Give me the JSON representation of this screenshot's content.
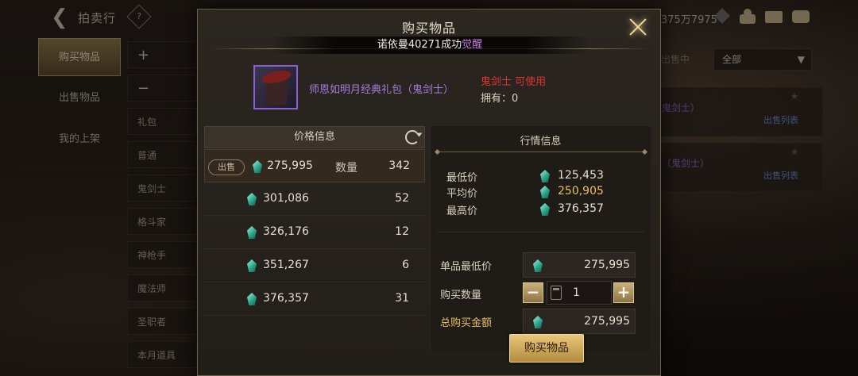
{
  "background": {
    "title": "拍卖行",
    "help_icon": "?",
    "currency": "375万7975",
    "left_tabs": [
      "购买物品",
      "出售物品",
      "我的上架"
    ],
    "categories": [
      "+",
      "−",
      "礼包",
      "普通",
      "鬼剑士",
      "格斗家",
      "神枪手",
      "魔法师",
      "圣职者",
      "本月道具"
    ],
    "filter_label": "出售中",
    "filter_value": "全部",
    "right_rows": [
      {
        "name": "鬼剑士）",
        "link": "出售列表"
      },
      {
        "name": "（鬼剑士）",
        "link": "出售列表"
      }
    ]
  },
  "modal": {
    "title": "购买物品",
    "toast_prefix": "诺依曼40271成功",
    "toast_highlight": "觉醒",
    "item": {
      "name": "师恩如明月经典礼包（鬼剑士）",
      "class_text": "鬼剑士 可使用",
      "own_text": "拥有：0"
    },
    "price_info": {
      "header": "价格信息",
      "sell_tag": "出售",
      "qty_label": "数量",
      "rows": [
        {
          "price": "275,995",
          "qty": "342"
        },
        {
          "price": "301,086",
          "qty": "52"
        },
        {
          "price": "326,176",
          "qty": "12"
        },
        {
          "price": "351,267",
          "qty": "6"
        },
        {
          "price": "376,357",
          "qty": "31"
        }
      ]
    },
    "market_info": {
      "header": "行情信息",
      "min_label": "最低价",
      "min_value": "125,453",
      "avg_label": "平均价",
      "avg_value": "250,905",
      "max_label": "最高价",
      "max_value": "376,357"
    },
    "purchase": {
      "unit_label": "单品最低价",
      "unit_value": "275,995",
      "qty_label": "购买数量",
      "qty_value": "1",
      "minus": "−",
      "plus": "+",
      "total_label": "总购买金额",
      "total_value": "275,995",
      "buy_button": "购买物品"
    }
  }
}
